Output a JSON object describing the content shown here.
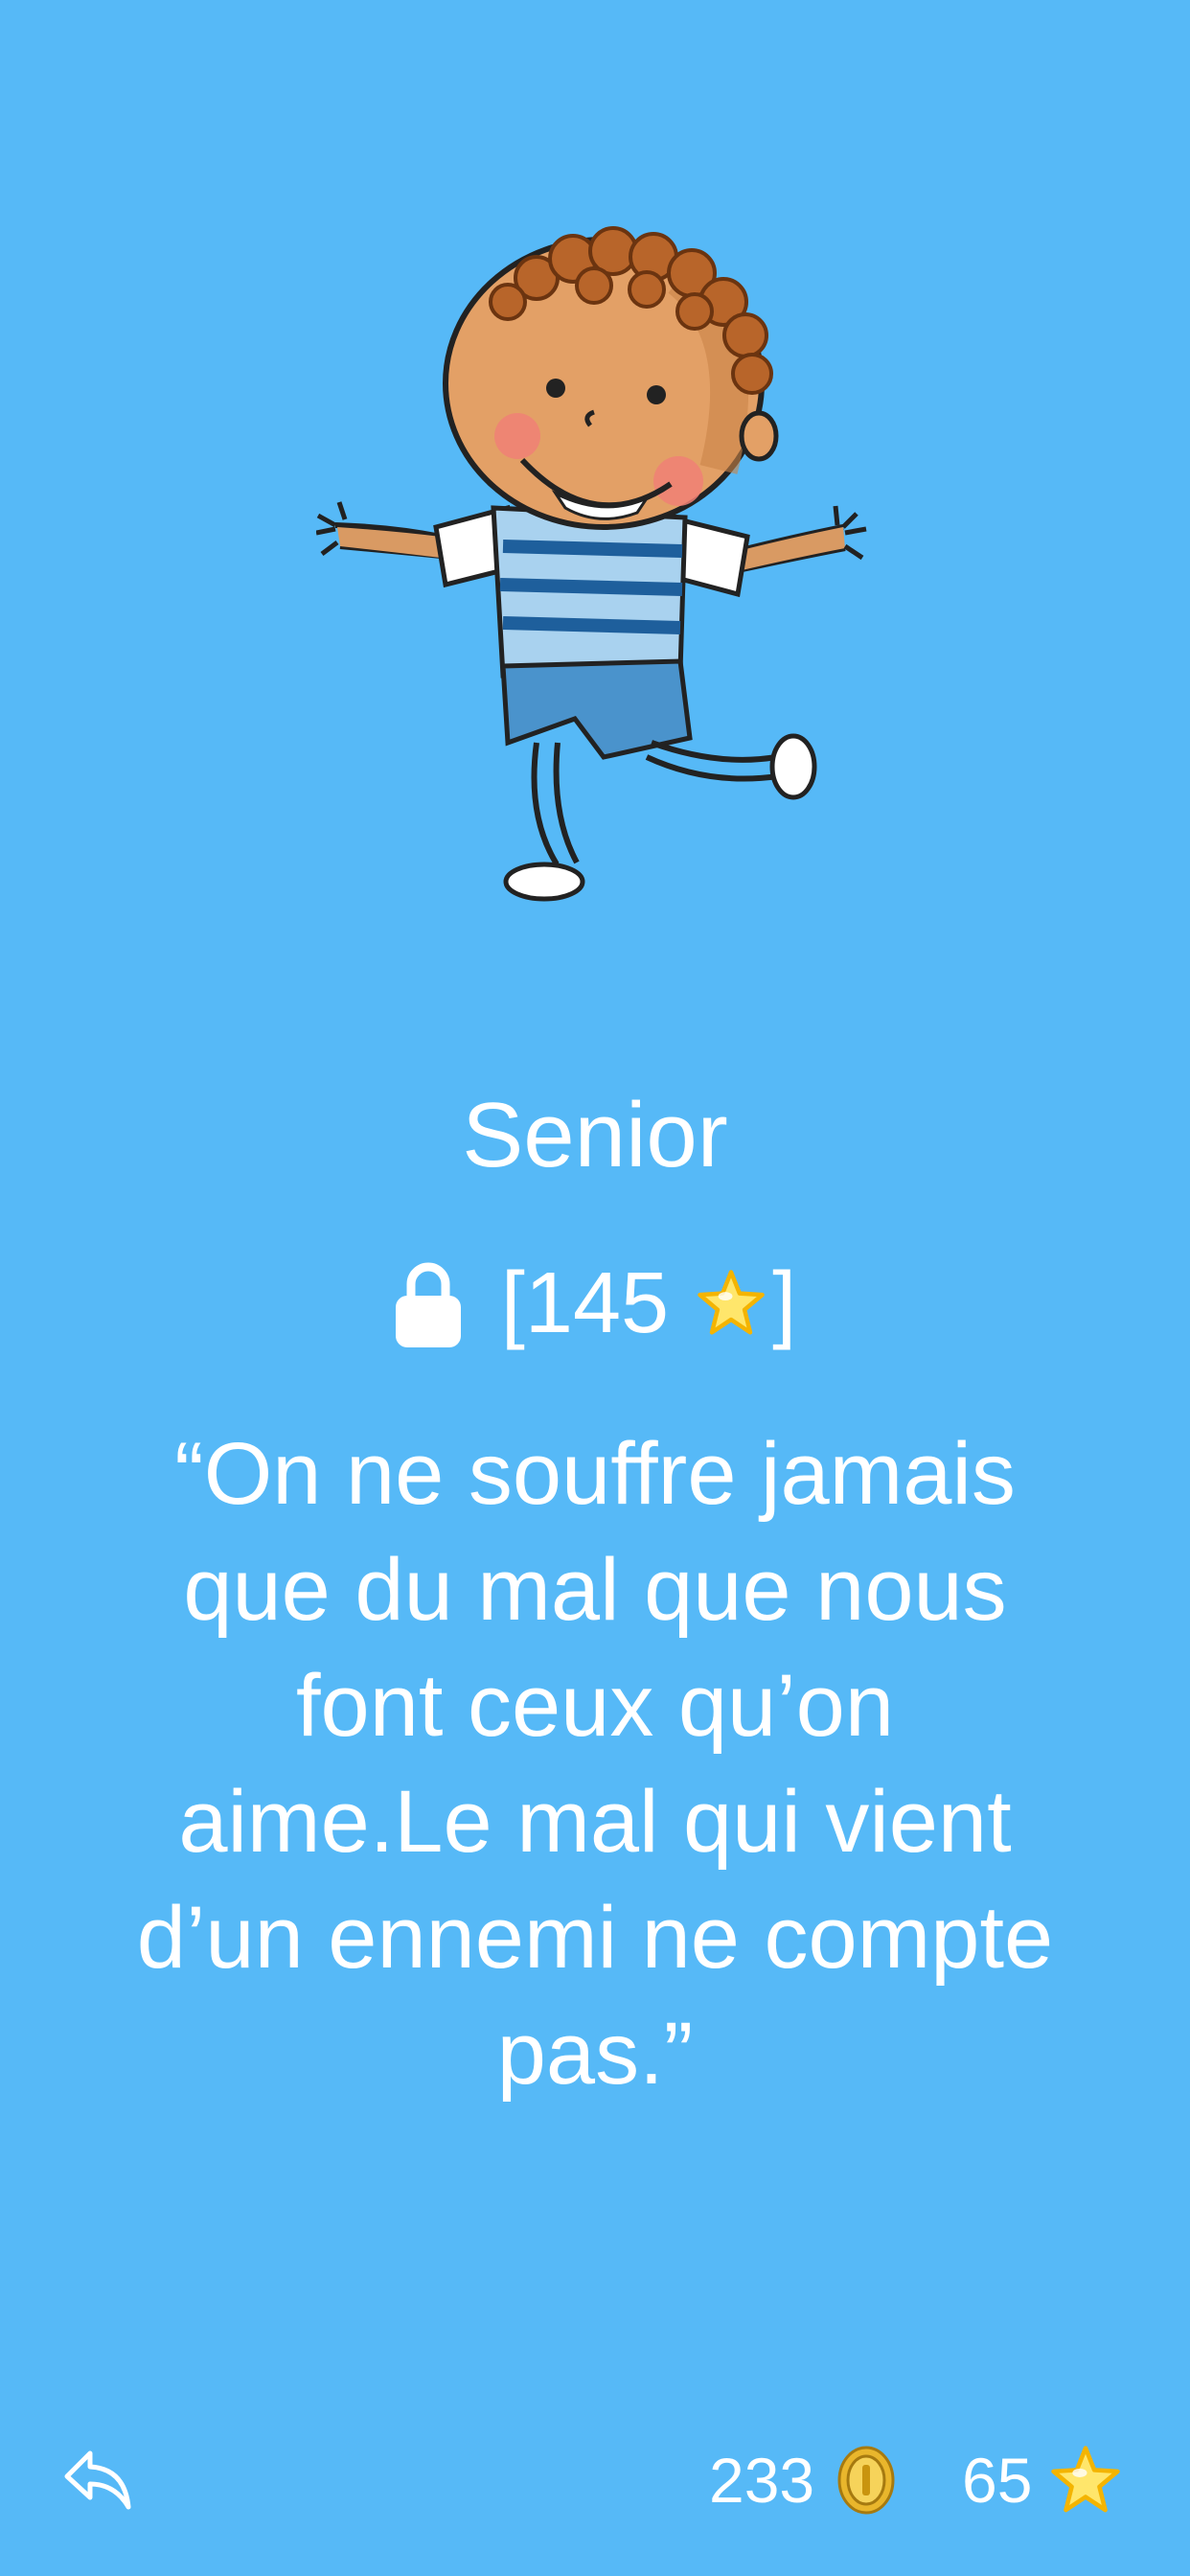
{
  "level": {
    "title": "Senior",
    "lock_icon": "lock-icon",
    "cost_open": "[145",
    "cost_close": "]",
    "cost_icon": "star-icon"
  },
  "quote": {
    "text": "“On ne souffre jamais que du mal que nous font ceux qu’on aime.Le mal qui vient d’un ennemi ne compte pas.”"
  },
  "footer": {
    "back_icon": "reply-arrow-icon",
    "coins": "233",
    "coin_icon": "gold-coin-icon",
    "stars": "65",
    "star_icon": "star-icon"
  },
  "colors": {
    "background": "#56b9f7",
    "text": "#ffffff",
    "star": "#ffe66b",
    "coin": "#e9b62c"
  }
}
